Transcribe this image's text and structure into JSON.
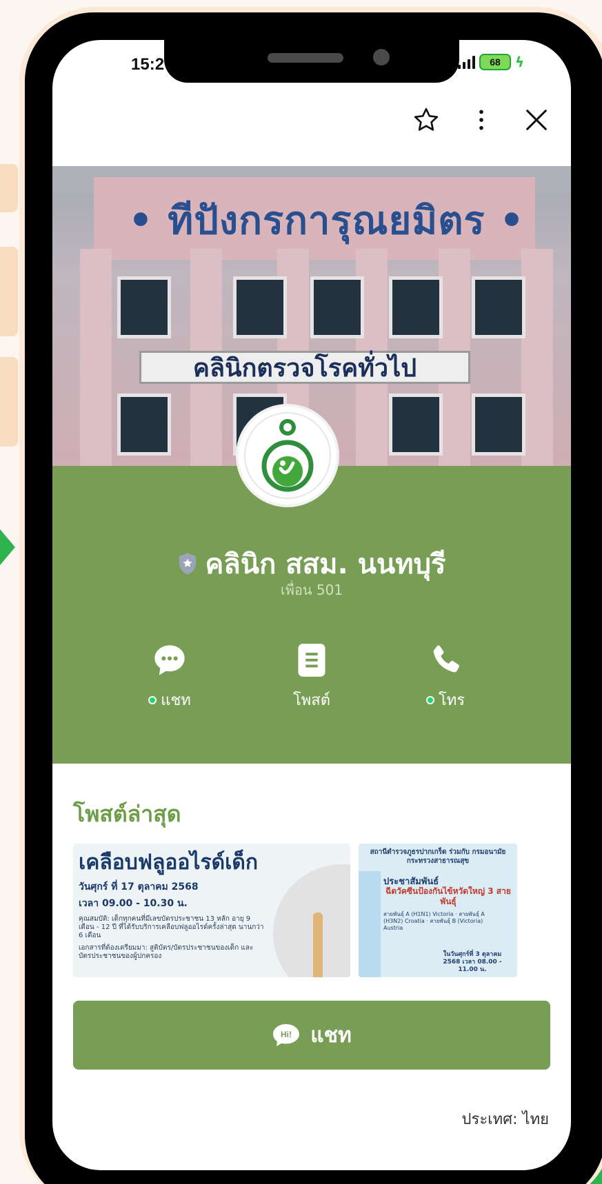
{
  "status_bar": {
    "time": "15:2",
    "battery": "68"
  },
  "top_bar": {
    "icons": [
      "star-icon",
      "more-vertical-icon",
      "close-icon"
    ]
  },
  "cover": {
    "building_sign": "• ทีปังกรการุณยมิตร •",
    "banner_text": "คลินิกตรวจโรคทั่วไป"
  },
  "profile": {
    "name": "คลินิก สสม. นนทบุรี",
    "friends": "เพื่อน 501",
    "actions": [
      {
        "label": "แชท",
        "icon": "chat-bubble-icon",
        "online": true
      },
      {
        "label": "โพสต์",
        "icon": "document-icon",
        "online": false
      },
      {
        "label": "โทร",
        "icon": "phone-icon",
        "online": true
      }
    ]
  },
  "posts": {
    "title": "โพสต์ล่าสุด",
    "post1": {
      "headline": "เคลือบฟลูออไรด์เด็ก",
      "date": "วันศุกร์ ที่ 17 ตุลาคม 2568",
      "time": "เวลา 09.00 - 10.30 น.",
      "qualification": "คุณสมบัติ: เด็กทุกคนที่มีเลขบัตรประชาชน 13 หลัก อายุ 9 เดือน - 12 ปี ที่ได้รับบริการเคลือบฟลูออไรด์ครั้งล่าสุด นานกว่า 6 เดือน",
      "documents": "เอกสารที่ต้องเตรียมมา: สูติบัตร/บัตรประชาชนของเด็ก และ บัตรประชาชนของผู้ปกครอง"
    },
    "post2": {
      "header": "สถานีตำรวจภูธรปากเกร็ด ร่วมกับ กรมอนามัย กระทรวงสาธารณสุข",
      "pr": "ประชาสัมพันธ์",
      "main": "ฉีดวัคซีนป้องกันไข้หวัดใหญ่ 3 สายพันธุ์",
      "strains": "สายพันธุ์ A (H1N1) Victoria · สายพันธุ์ A (H3N2) Croatia · สายพันธุ์ B (Victoria) Austria",
      "date": "ในวันศุกร์ที่ 3 ตุลาคม 2568 เวลา 08.00 - 11.00 น."
    }
  },
  "chat_button": {
    "label": "แชท",
    "badge": "Hi!"
  },
  "country": "ประเทศ: ไทย"
}
